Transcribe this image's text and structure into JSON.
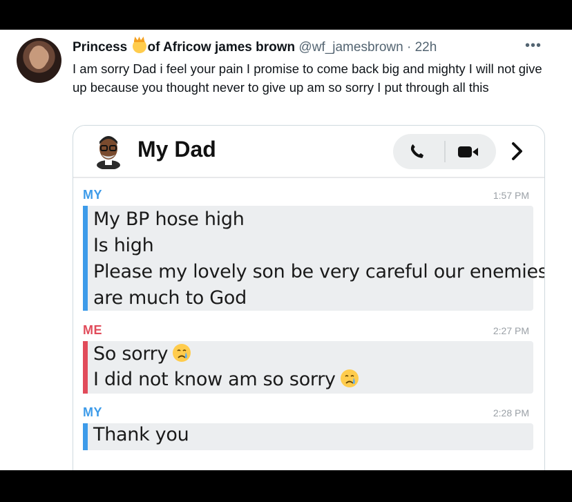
{
  "tweet": {
    "display_name_part1": "Princess",
    "display_name_part2": "of Africow james brown",
    "handle": "@wf_jamesbrown",
    "separator": "·",
    "time": "22h",
    "more": "•••",
    "text": "I am sorry Dad i feel your pain I promise to come back big and mighty I will not give up because you thought never to give up am so sorry I put through all this"
  },
  "chat": {
    "title": "My Dad",
    "messages": [
      {
        "sender": "MY",
        "time": "1:57 PM",
        "color": "#3d9be9",
        "lines": [
          "My BP hose high",
          "Is high",
          "Please my lovely son be very careful our enemies",
          "are much to God"
        ]
      },
      {
        "sender": "ME",
        "time": "2:27 PM",
        "color": "#e14b5a",
        "lines": [
          "So sorry",
          "I did not know am so sorry"
        ]
      },
      {
        "sender": "MY",
        "time": "2:28 PM",
        "color": "#3d9be9",
        "lines": [
          "Thank you"
        ]
      }
    ]
  },
  "icons": {
    "phone": "phone-icon",
    "video": "video-camera-icon",
    "chevron": "chevron-right-icon",
    "cry": "crying-face-emoji-icon",
    "crown": "princess-emoji-icon"
  }
}
